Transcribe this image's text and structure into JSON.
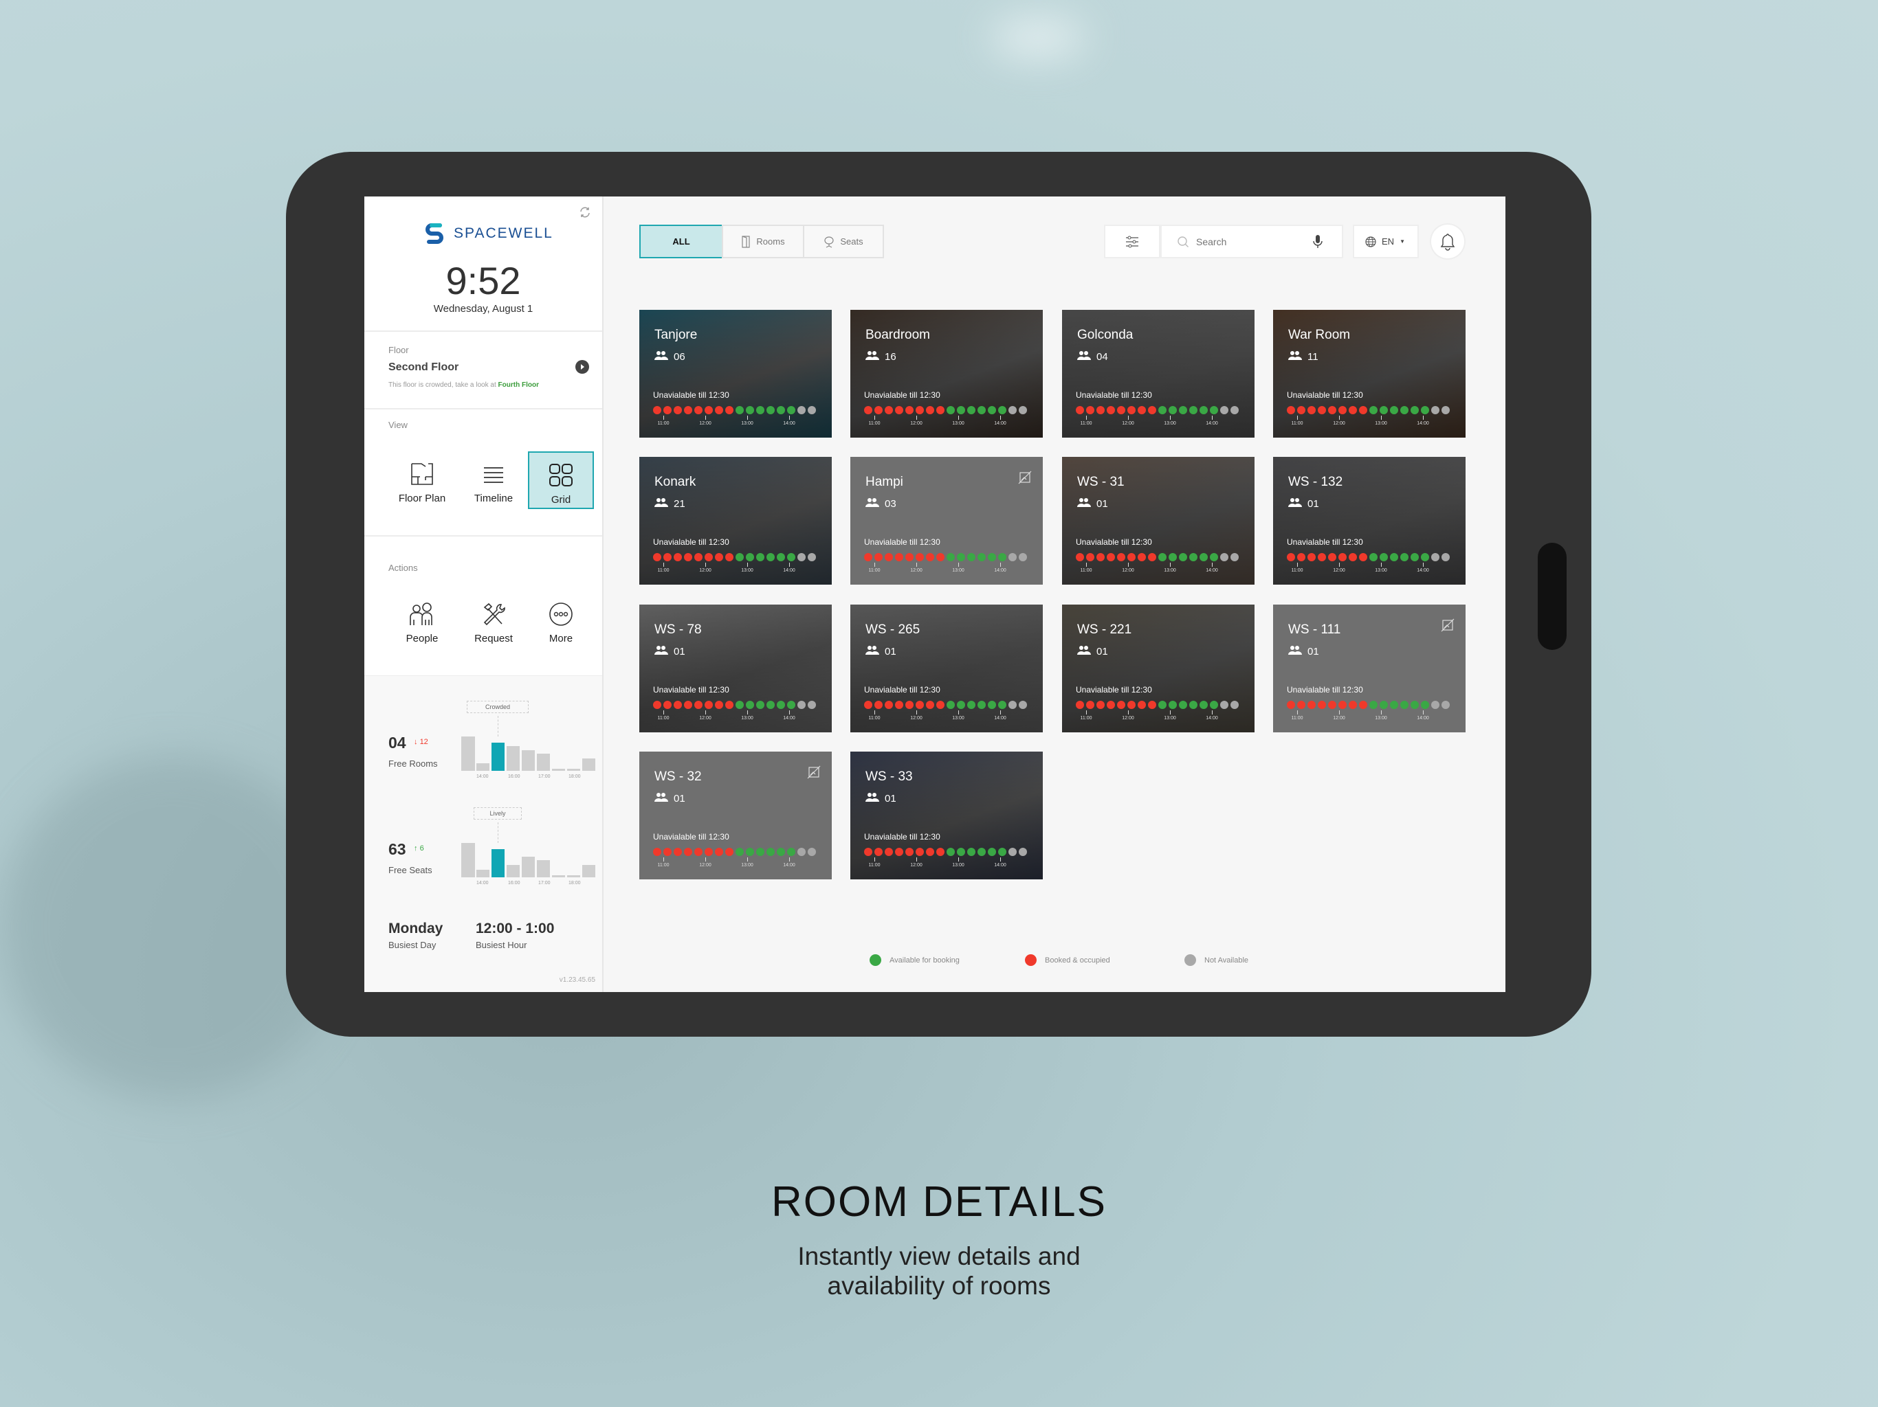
{
  "colors": {
    "accent": "#10a6b4",
    "available": "#3aa845",
    "booked": "#f0392b",
    "not_available": "#a8a8a8",
    "link_green": "#3a9c3a"
  },
  "sidebar": {
    "logo_text": "SPACEWELL",
    "time": "9:52",
    "date": "Wednesday, August 1",
    "floor": {
      "label": "Floor",
      "name": "Second Floor",
      "note": "This floor is crowded, take a look at ",
      "note_link": "Fourth Floor"
    },
    "view": {
      "label": "View",
      "items": [
        {
          "label": "Floor Plan",
          "icon": "floor-plan-icon"
        },
        {
          "label": "Timeline",
          "icon": "timeline-icon"
        },
        {
          "label": "Grid",
          "icon": "grid-icon",
          "active": true
        }
      ]
    },
    "actions": {
      "label": "Actions",
      "items": [
        {
          "label": "People",
          "icon": "people-icon"
        },
        {
          "label": "Request",
          "icon": "tools-icon"
        },
        {
          "label": "More",
          "icon": "more-icon"
        }
      ]
    },
    "stats": [
      {
        "value": "04",
        "delta": "12",
        "direction": "down",
        "label": "Free Rooms",
        "tag": "Crowded",
        "bars": [
          100,
          23,
          83,
          72,
          61,
          51,
          7,
          7,
          37
        ],
        "highlight": 2,
        "ticks": [
          "14:00",
          "16:00",
          "17:00",
          "18:00"
        ]
      },
      {
        "value": "63",
        "delta": "6",
        "direction": "up",
        "label": "Free Seats",
        "tag": "Lively",
        "bars": [
          100,
          23,
          83,
          37,
          61,
          51,
          7,
          7,
          37
        ],
        "highlight": 2,
        "ticks": [
          "14:00",
          "16:00",
          "17:00",
          "18:00"
        ]
      }
    ],
    "busiest_day": {
      "value": "Monday",
      "label": "Busiest Day"
    },
    "busiest_hour": {
      "value": "12:00 - 1:00",
      "label": "Busiest Hour"
    },
    "version": "v1.23.45.65"
  },
  "toolbar": {
    "tabs": [
      {
        "label": "ALL",
        "active": true
      },
      {
        "label": "Rooms",
        "icon": "door-icon"
      },
      {
        "label": "Seats",
        "icon": "chair-icon"
      }
    ],
    "search_placeholder": "Search",
    "language": "EN"
  },
  "timeline_ticks": [
    "11:00",
    "12:00",
    "13:00",
    "14:00"
  ],
  "rooms": [
    {
      "name": "Tanjore",
      "capacity": "06",
      "status": "Unavialable till 12:30",
      "image": true,
      "tone": "#1d4d5c"
    },
    {
      "name": "Boardroom",
      "capacity": "16",
      "status": "Unavialable till 12:30",
      "image": true,
      "tone": "#3a2f27"
    },
    {
      "name": "Golconda",
      "capacity": "04",
      "status": "Unavialable till 12:30",
      "image": true,
      "tone": "#4e4e4e"
    },
    {
      "name": "War Room",
      "capacity": "11",
      "status": "Unavialable till 12:30",
      "image": true,
      "tone": "#4a3526"
    },
    {
      "name": "Konark",
      "capacity": "21",
      "status": "Unavialable till 12:30",
      "image": true,
      "tone": "#3a4650"
    },
    {
      "name": "Hampi",
      "capacity": "03",
      "status": "Unavialable till 12:30",
      "image": false
    },
    {
      "name": "WS - 31",
      "capacity": "01",
      "status": "Unavialable till 12:30",
      "image": true,
      "tone": "#5a4d44"
    },
    {
      "name": "WS - 132",
      "capacity": "01",
      "status": "Unavialable till 12:30",
      "image": true,
      "tone": "#4a4a4c"
    },
    {
      "name": "WS - 78",
      "capacity": "01",
      "status": "Unavialable till 12:30",
      "image": true,
      "tone": "#6a6a6a"
    },
    {
      "name": "WS - 265",
      "capacity": "01",
      "status": "Unavialable till 12:30",
      "image": true,
      "tone": "#606060"
    },
    {
      "name": "WS - 221",
      "capacity": "01",
      "status": "Unavialable till 12:30",
      "image": true,
      "tone": "#4f4a40"
    },
    {
      "name": "WS - 111",
      "capacity": "01",
      "status": "Unavialable till 12:30",
      "image": false
    },
    {
      "name": "WS - 32",
      "capacity": "01",
      "status": "Unavialable till 12:30",
      "image": false
    },
    {
      "name": "WS - 33",
      "capacity": "01",
      "status": "Unavialable till 12:30",
      "image": true,
      "tone": "#33394a"
    }
  ],
  "slots": [
    "booked",
    "booked",
    "booked",
    "booked",
    "booked",
    "booked",
    "booked",
    "booked",
    "available",
    "available",
    "available",
    "available",
    "available",
    "available",
    "not_available",
    "not_available"
  ],
  "legend": [
    {
      "label": "Available for booking",
      "status": "available"
    },
    {
      "label": "Booked & occupied",
      "status": "booked"
    },
    {
      "label": "Not Available",
      "status": "not_available"
    }
  ],
  "caption": {
    "title": "ROOM DETAILS",
    "subtitle_1": "Instantly view details and",
    "subtitle_2": "availability of rooms"
  }
}
